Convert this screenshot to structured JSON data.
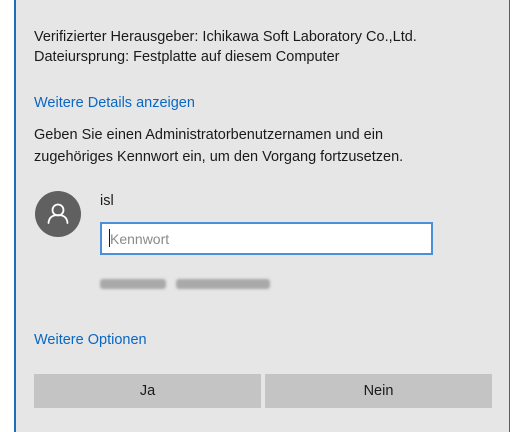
{
  "publisher": {
    "line": "Verifizierter Herausgeber: Ichikawa Soft Laboratory Co.,Ltd."
  },
  "origin": {
    "line": "Dateiursprung: Festplatte auf diesem Computer"
  },
  "details_link": "Weitere Details anzeigen",
  "prompt": {
    "line1": "Geben Sie einen Administratorbenutzernamen und ein",
    "line2": "zugehöriges Kennwort ein, um den Vorgang fortzusetzen."
  },
  "user": {
    "name": "isl",
    "avatar_icon": "user-icon",
    "avatar_color": "#606060"
  },
  "password": {
    "placeholder": "Kennwort",
    "value": ""
  },
  "more_options_link": "Weitere Optionen",
  "buttons": {
    "yes": "Ja",
    "no": "Nein"
  },
  "colors": {
    "accent": "#0a67c2",
    "dialog_bg": "#e6e6e6",
    "button_bg": "#c4c4c4",
    "input_border": "#4a90d9"
  }
}
